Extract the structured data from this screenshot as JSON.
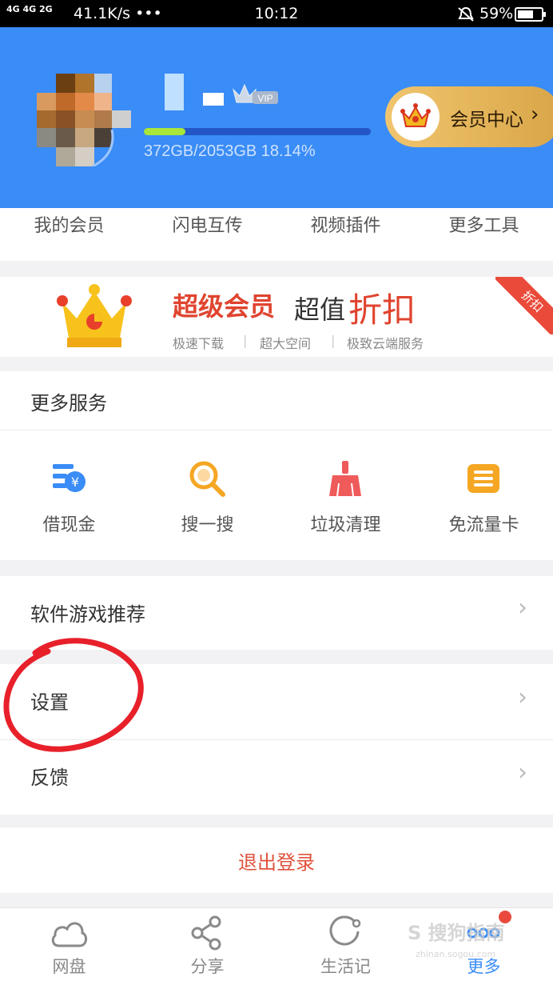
{
  "status_bar": {
    "network": "4G 4G 2G",
    "speed": "41.1K/s •••",
    "time": "10:12",
    "battery": "59%"
  },
  "header": {
    "vip_tag": "VIP",
    "quota": "372GB/2053GB  18.14%",
    "quota_used_fraction": 0.1814,
    "vip_center_label": "会员中心",
    "accent_color": "#3a8cf6"
  },
  "quick_tabs": [
    "我的会员",
    "闪电互传",
    "视频插件",
    "更多工具"
  ],
  "banner": {
    "title": "超级会员",
    "sub_plain": "超值",
    "sub_red": "折扣",
    "features": [
      "极速下载",
      "超大空间",
      "极致云端服务"
    ],
    "ribbon": "折扣"
  },
  "more_services": {
    "title": "更多服务",
    "items": [
      {
        "label": "借现金",
        "icon": "cash-icon"
      },
      {
        "label": "搜一搜",
        "icon": "search-icon"
      },
      {
        "label": "垃圾清理",
        "icon": "broom-icon"
      },
      {
        "label": "免流量卡",
        "icon": "sim-card-icon"
      }
    ]
  },
  "rows": {
    "recommend": "软件游戏推荐",
    "settings": "设置",
    "feedback": "反馈"
  },
  "logout_label": "退出登录",
  "tab_bar": {
    "items": [
      {
        "label": "网盘",
        "icon": "cloud-icon"
      },
      {
        "label": "分享",
        "icon": "share-icon"
      },
      {
        "label": "生活记",
        "icon": "life-icon"
      },
      {
        "label": "更多",
        "icon": "more-icon"
      }
    ]
  },
  "watermark": {
    "text": "S 搜狗指南",
    "url": "zhinan.sogou.com"
  }
}
